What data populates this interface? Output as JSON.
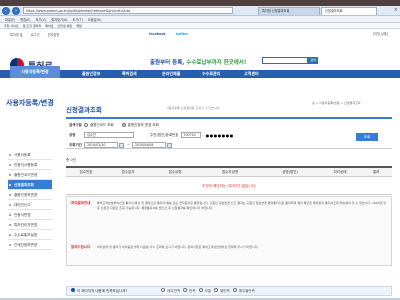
{
  "browser": {
    "url": "https://www.patent.go.kr/jsp/ka/prestep/retrieveSignLineList.do",
    "tabs": [
      "특허청 신청결과조회",
      "신청결과조회"
    ],
    "menu": [
      "파일(F)",
      "편집(E)",
      "보기(V)",
      "즐겨찾기(A)",
      "도구(T)",
      "도움말(H)"
    ],
    "favorites": [
      "추천 사이트",
      "웹 조각 갤러리",
      "특허로",
      "인터넷 뱅킹",
      "메일"
    ]
  },
  "topline": {
    "links": [
      "특허청 홈",
      "로그인",
      "전자출원"
    ],
    "sns": {
      "facebook": "facebook",
      "twitter": "twitter"
    },
    "right": "[저장 상품]"
  },
  "header": {
    "logo_text": "특허로",
    "slogan_main": "출원부터 등록, ",
    "slogan_green": "수수료납부까지 한곳에서!",
    "search_button": "검색"
  },
  "gnb": {
    "first": "사용자등록/변경",
    "items": [
      "출원인정보",
      "특허검색",
      "온라인제출",
      "수수료관리",
      "고객센터"
    ]
  },
  "sidebar": {
    "title": "사용자등록/변경",
    "items": [
      "사용자등록",
      "인증서사용등록",
      "출원인코드변경",
      "신청결과조회",
      "출원인정보변경",
      "대리인신고",
      "인증서변경",
      "특허관리자변경",
      "수수료통보설정",
      "관계인정보변경"
    ],
    "active_index": 3
  },
  "main": {
    "breadcrumb": "홈 > 사용자등록/변경 > 신청결과조회",
    "title": "신청결과조회",
    "description": "사용자등록 신청결과를 조회할 수 있습니다.",
    "form": {
      "row1_label": "검색구분",
      "row1_options": [
        "출원인코드 조회",
        "출원인정보 변경 조회"
      ],
      "row2_label": "성명",
      "row2_value": "김수진",
      "row2_id_label": "주민(법인)등록번호",
      "row2_id_value": "700720",
      "row2_masked": "●●●●●●●",
      "row3_label": "조회기간",
      "row3_from": "2010/02/10",
      "row3_to": "2010/04/09",
      "search_button": "조회"
    },
    "results_count": "총 0건",
    "table_headers": [
      "접수번호",
      "접수일자",
      "접수유형",
      "접수자성명",
      "성명(법인)",
      "처리상태",
      "결과"
    ],
    "empty_message": "조건에 해당하는 데이터가 없습니다.",
    "notice": {
      "head1": "처리결과안내",
      "body1": "특허고객번호부여신청 통지서 발신 및 결정으로 통지서 발송 또는 전자문서로 통지됩니다. 출원인 정보변경 신고 결과는 출원인 정보변경 결과통지서로 통지되며 결과 확인은 특허로의 통지서조회 메뉴에서 할 수 있습니다. 2005년 이후 신청한 자료만 조회 가능합니다. 결정통지서를 받으신 후 신청결과를 확인하시기 바랍니다.",
      "head2": "알려드립니다",
      "body2": "처리상태 및 결과가 처리중일 경우 다음날 다시 조회해 보시기 바랍니다. 문의사항은 특허고객상담센터로 연락해 주시기 바랍니다."
    },
    "survey": {
      "question": "이 페이지의 내용에 만족하십니까?",
      "options": [
        "매우만족",
        "만족",
        "보통",
        "불만족",
        "매우불만족"
      ]
    }
  },
  "colors": {
    "brand": "#2a5db0",
    "accent": "#3a7bd5",
    "alert": "#d03030",
    "green": "#2d9a3e"
  }
}
